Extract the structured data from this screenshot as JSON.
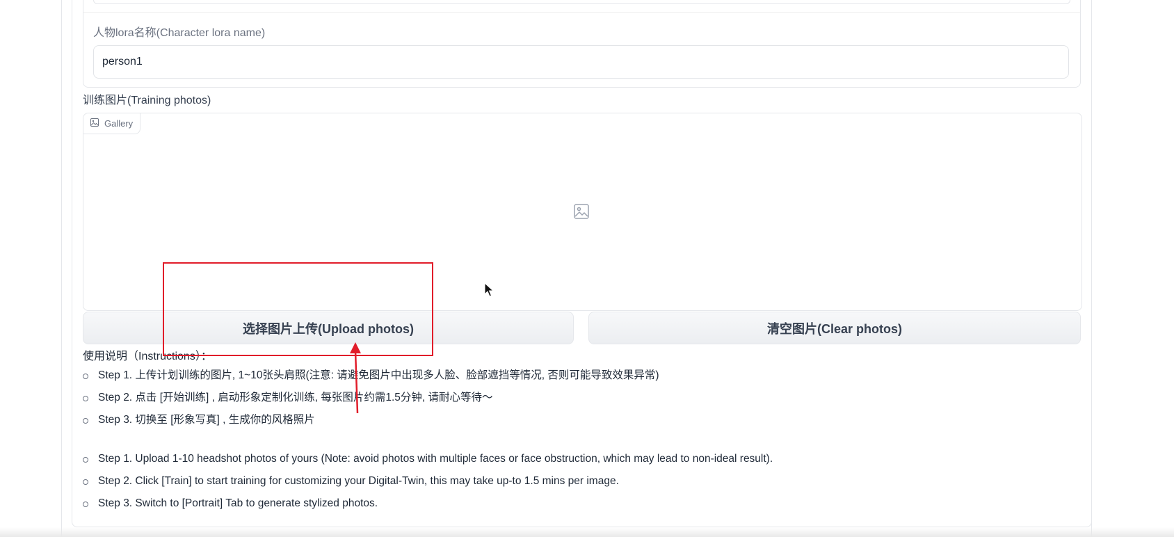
{
  "form": {
    "lora_label": "人物lora名称(Character lora name)",
    "lora_value": "person1",
    "photos_label": "训练图片(Training photos)",
    "gallery_tag": "Gallery"
  },
  "buttons": {
    "upload": "选择图片上传(Upload photos)",
    "clear": "清空图片(Clear photos)"
  },
  "instructions": {
    "title": "使用说明（Instructions）：",
    "steps_cn": [
      "Step 1. 上传计划训练的图片, 1~10张头肩照(注意: 请避免图片中出现多人脸、脸部遮挡等情况, 否则可能导致效果异常)",
      "Step 2. 点击 [开始训练] , 启动形象定制化训练, 每张图片约需1.5分钟, 请耐心等待～",
      "Step 3. 切换至 [形象写真] , 生成你的风格照片"
    ],
    "steps_en": [
      "Step 1. Upload 1-10 headshot photos of yours (Note: avoid photos with multiple faces or face obstruction, which may lead to non-ideal result).",
      "Step 2. Click [Train] to start training for customizing your Digital-Twin, this may take up-to 1.5 mins per image.",
      "Step 3. Switch to [Portrait] Tab to generate stylized photos."
    ]
  },
  "icons": {
    "gallery_tag": "image-icon",
    "placeholder": "image-placeholder-icon",
    "cursor": "mouse-cursor-icon"
  },
  "colors": {
    "annotation": "#e11d2a",
    "button_bg": "#eceef1",
    "border": "#e5e7eb"
  }
}
